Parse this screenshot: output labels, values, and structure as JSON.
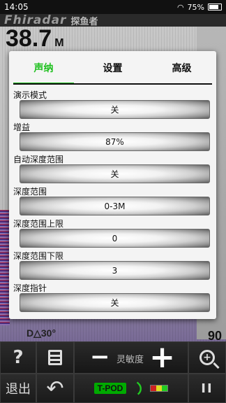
{
  "status_bar": {
    "time": "14:05",
    "battery": "75%"
  },
  "app": {
    "brand": "Fhiradar",
    "brand_cn": "探鱼者",
    "depth_value": "38.7",
    "depth_unit": "M",
    "scale_value": "90",
    "mode": "D△30°"
  },
  "dialog": {
    "tabs": [
      "声纳",
      "设置",
      "高级"
    ],
    "active_tab": "声纳",
    "settings": [
      {
        "label": "演示模式",
        "value": "关"
      },
      {
        "label": "增益",
        "value": "87%"
      },
      {
        "label": "自动深度范围",
        "value": "关"
      },
      {
        "label": "深度范围",
        "value": "0-3M"
      },
      {
        "label": "深度范围上限",
        "value": "0"
      },
      {
        "label": "深度范围下限",
        "value": "3"
      },
      {
        "label": "深度指针",
        "value": "关"
      }
    ]
  },
  "toolbar": {
    "help": "?",
    "sensitivity_label": "灵敏度",
    "minus": "−",
    "plus": "+",
    "exit": "退出",
    "back": "↶",
    "tpod": "T-POD",
    "pause": "II"
  },
  "colors": {
    "accent": "#1ec01e",
    "dialog_bg": "#f4f4f4",
    "toolbar_bg": "#1e1e1e"
  }
}
